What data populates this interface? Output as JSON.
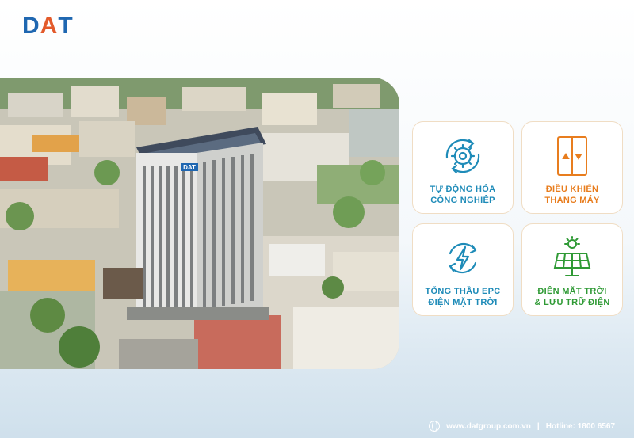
{
  "brand": {
    "logo_d": "D",
    "logo_a": "A",
    "logo_t": "T"
  },
  "services": [
    {
      "label": "TỰ ĐỘNG HÓA\nCÔNG NGHIỆP",
      "icon": "gear-cycle-icon",
      "color": "#1e8bb8"
    },
    {
      "label": "ĐIỀU KHIỂN\nTHANG MÁY",
      "icon": "elevator-icon",
      "color": "#e87d1e"
    },
    {
      "label": "TỔNG THẦU EPC\nĐIỆN MẶT TRỜI",
      "icon": "energy-bolt-icon",
      "color": "#1e8bb8"
    },
    {
      "label": "ĐIỆN MẶT TRỜI\n& LƯU TRỮ ĐIỆN",
      "icon": "solar-panel-icon",
      "color": "#2f9a35"
    }
  ],
  "footer": {
    "website": "www.datgroup.com.vn",
    "separator": "|",
    "hotline": "Hotline: 1800 6567"
  },
  "photo": {
    "building_sign": "DAT"
  }
}
